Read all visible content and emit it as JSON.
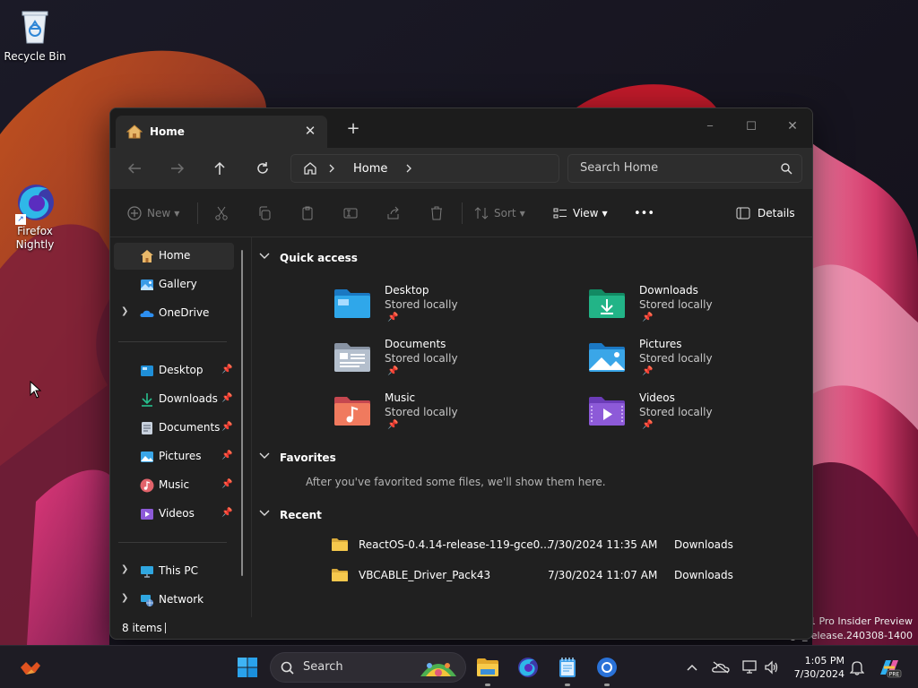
{
  "desktop": {
    "icons": [
      {
        "label": "Recycle Bin",
        "icon": "recycle-bin-icon"
      },
      {
        "label": "Firefox\nNightly",
        "icon": "firefox-nightly-icon"
      }
    ],
    "watermark": {
      "line1": "11 Pro Insider Preview",
      "line2": "ge_release.240308-1400"
    }
  },
  "window": {
    "tab": {
      "title": "Home",
      "icon": "home-icon",
      "close": "✕"
    },
    "new_tab": "+",
    "controls": {
      "minimize": "─",
      "maximize": "☐",
      "close": "✕"
    },
    "address": {
      "breadcrumb": "Home"
    },
    "search": {
      "placeholder": "Search Home"
    },
    "toolbar": {
      "new_label": "New",
      "sort_label": "Sort",
      "view_label": "View",
      "more_label": "•••",
      "details_label": "Details"
    },
    "sidebar": {
      "top": [
        {
          "label": "Home",
          "icon": "home-icon",
          "selected": true
        },
        {
          "label": "Gallery",
          "icon": "gallery-icon"
        },
        {
          "label": "OneDrive",
          "icon": "onedrive-icon",
          "expandable": true
        }
      ],
      "pinned": [
        {
          "label": "Desktop",
          "icon": "desktop-folder-icon"
        },
        {
          "label": "Downloads",
          "icon": "downloads-icon"
        },
        {
          "label": "Documents",
          "icon": "documents-icon"
        },
        {
          "label": "Pictures",
          "icon": "pictures-icon"
        },
        {
          "label": "Music",
          "icon": "music-icon"
        },
        {
          "label": "Videos",
          "icon": "videos-icon"
        }
      ],
      "bottom": [
        {
          "label": "This PC",
          "icon": "this-pc-icon"
        },
        {
          "label": "Network",
          "icon": "network-icon"
        }
      ]
    },
    "sections": {
      "quick_access": "Quick access",
      "favorites": "Favorites",
      "recent": "Recent"
    },
    "quick_access": [
      {
        "name": "Desktop",
        "sub": "Stored locally",
        "color": "#2f9be0"
      },
      {
        "name": "Downloads",
        "sub": "Stored locally",
        "color": "#23b488"
      },
      {
        "name": "Documents",
        "sub": "Stored locally",
        "color": "#aab4c3"
      },
      {
        "name": "Pictures",
        "sub": "Stored locally",
        "color": "#3aa6e8"
      },
      {
        "name": "Music",
        "sub": "Stored locally",
        "color": "#e2636b"
      },
      {
        "name": "Videos",
        "sub": "Stored locally",
        "color": "#8d5ad8"
      }
    ],
    "favorites_message": "After you've favorited some files, we'll show them here.",
    "recent": [
      {
        "name": "ReactOS-0.4.14-release-119-gce0...",
        "date": "7/30/2024 11:35 AM",
        "location": "Downloads"
      },
      {
        "name": "VBCABLE_Driver_Pack43",
        "date": "7/30/2024 11:07 AM",
        "location": "Downloads"
      }
    ],
    "status": {
      "item_count": "8 items"
    }
  },
  "taskbar": {
    "search_placeholder": "Search",
    "time": "1:05 PM",
    "date": "7/30/2024"
  }
}
